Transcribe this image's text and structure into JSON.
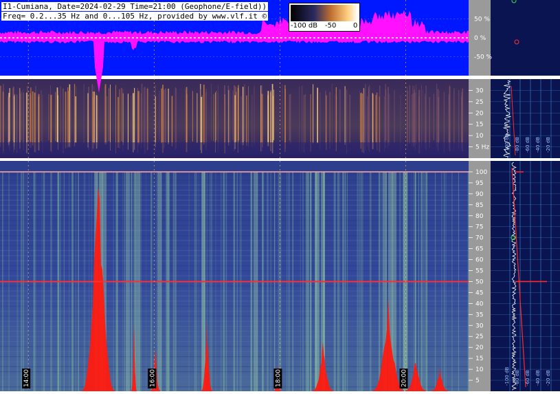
{
  "header": {
    "line1": "I1-Cumiana, Date=2024-02-29 Time=21:00 (Geophone/E-field))",
    "line2": "Freq= 0.2...35 Hz and 0...105 Hz, provided by www.vlf.it ©"
  },
  "colorbar": {
    "labels": [
      "-100 dB",
      "-50",
      "0"
    ]
  },
  "colors": {
    "waveform_bg": "#0018ff",
    "waveform_signal": "#ff10ff",
    "axis_bg": "#9a9a9a",
    "side_bg": "#0a1450",
    "spectrum_curve": "#ffffff",
    "fit_line": "#ff2a2a",
    "grid_line": "#3a8ad8"
  },
  "chart_data": [
    {
      "type": "area",
      "panel": "waveform",
      "y_tick_labels": [
        "50 %",
        "0 %",
        "-50 %"
      ],
      "y_tick_values": [
        50,
        0,
        -50
      ],
      "ylim": [
        -100,
        100
      ]
    },
    {
      "type": "heatmap",
      "panel": "spectrogram-low",
      "y_tick_labels": [
        "30",
        "25",
        "20",
        "15",
        "10",
        "5 Hz"
      ],
      "y_tick_values": [
        30,
        25,
        20,
        15,
        10,
        5
      ],
      "ylim": [
        0.2,
        35
      ],
      "spectrum_axis_labels": [
        "-100 dB",
        "-80 dB",
        "-60 dB",
        "-40 dB",
        "-20 dB"
      ]
    },
    {
      "type": "heatmap",
      "panel": "spectrogram-high",
      "y_tick_labels": [
        "100",
        "95",
        "90",
        "85",
        "80",
        "75",
        "70",
        "65",
        "60",
        "55",
        "50",
        "45",
        "40",
        "35",
        "30",
        "25",
        "20",
        "15",
        "10",
        "5"
      ],
      "y_tick_values": [
        100,
        95,
        90,
        85,
        80,
        75,
        70,
        65,
        60,
        55,
        50,
        45,
        40,
        35,
        30,
        25,
        20,
        15,
        10,
        5
      ],
      "ylim": [
        0,
        105
      ],
      "x_time_labels": [
        "14:00",
        "16:00",
        "18:00",
        "20:00"
      ],
      "x_time_hours": [
        14,
        16,
        18,
        20
      ],
      "x_range_hours": [
        13.55,
        21.0
      ],
      "spectrum_axis_labels": [
        "-100 dB",
        "-80 dB",
        "-60 dB",
        "-40 dB",
        "-20 dB"
      ],
      "lines_hz": [
        50,
        100
      ]
    }
  ]
}
